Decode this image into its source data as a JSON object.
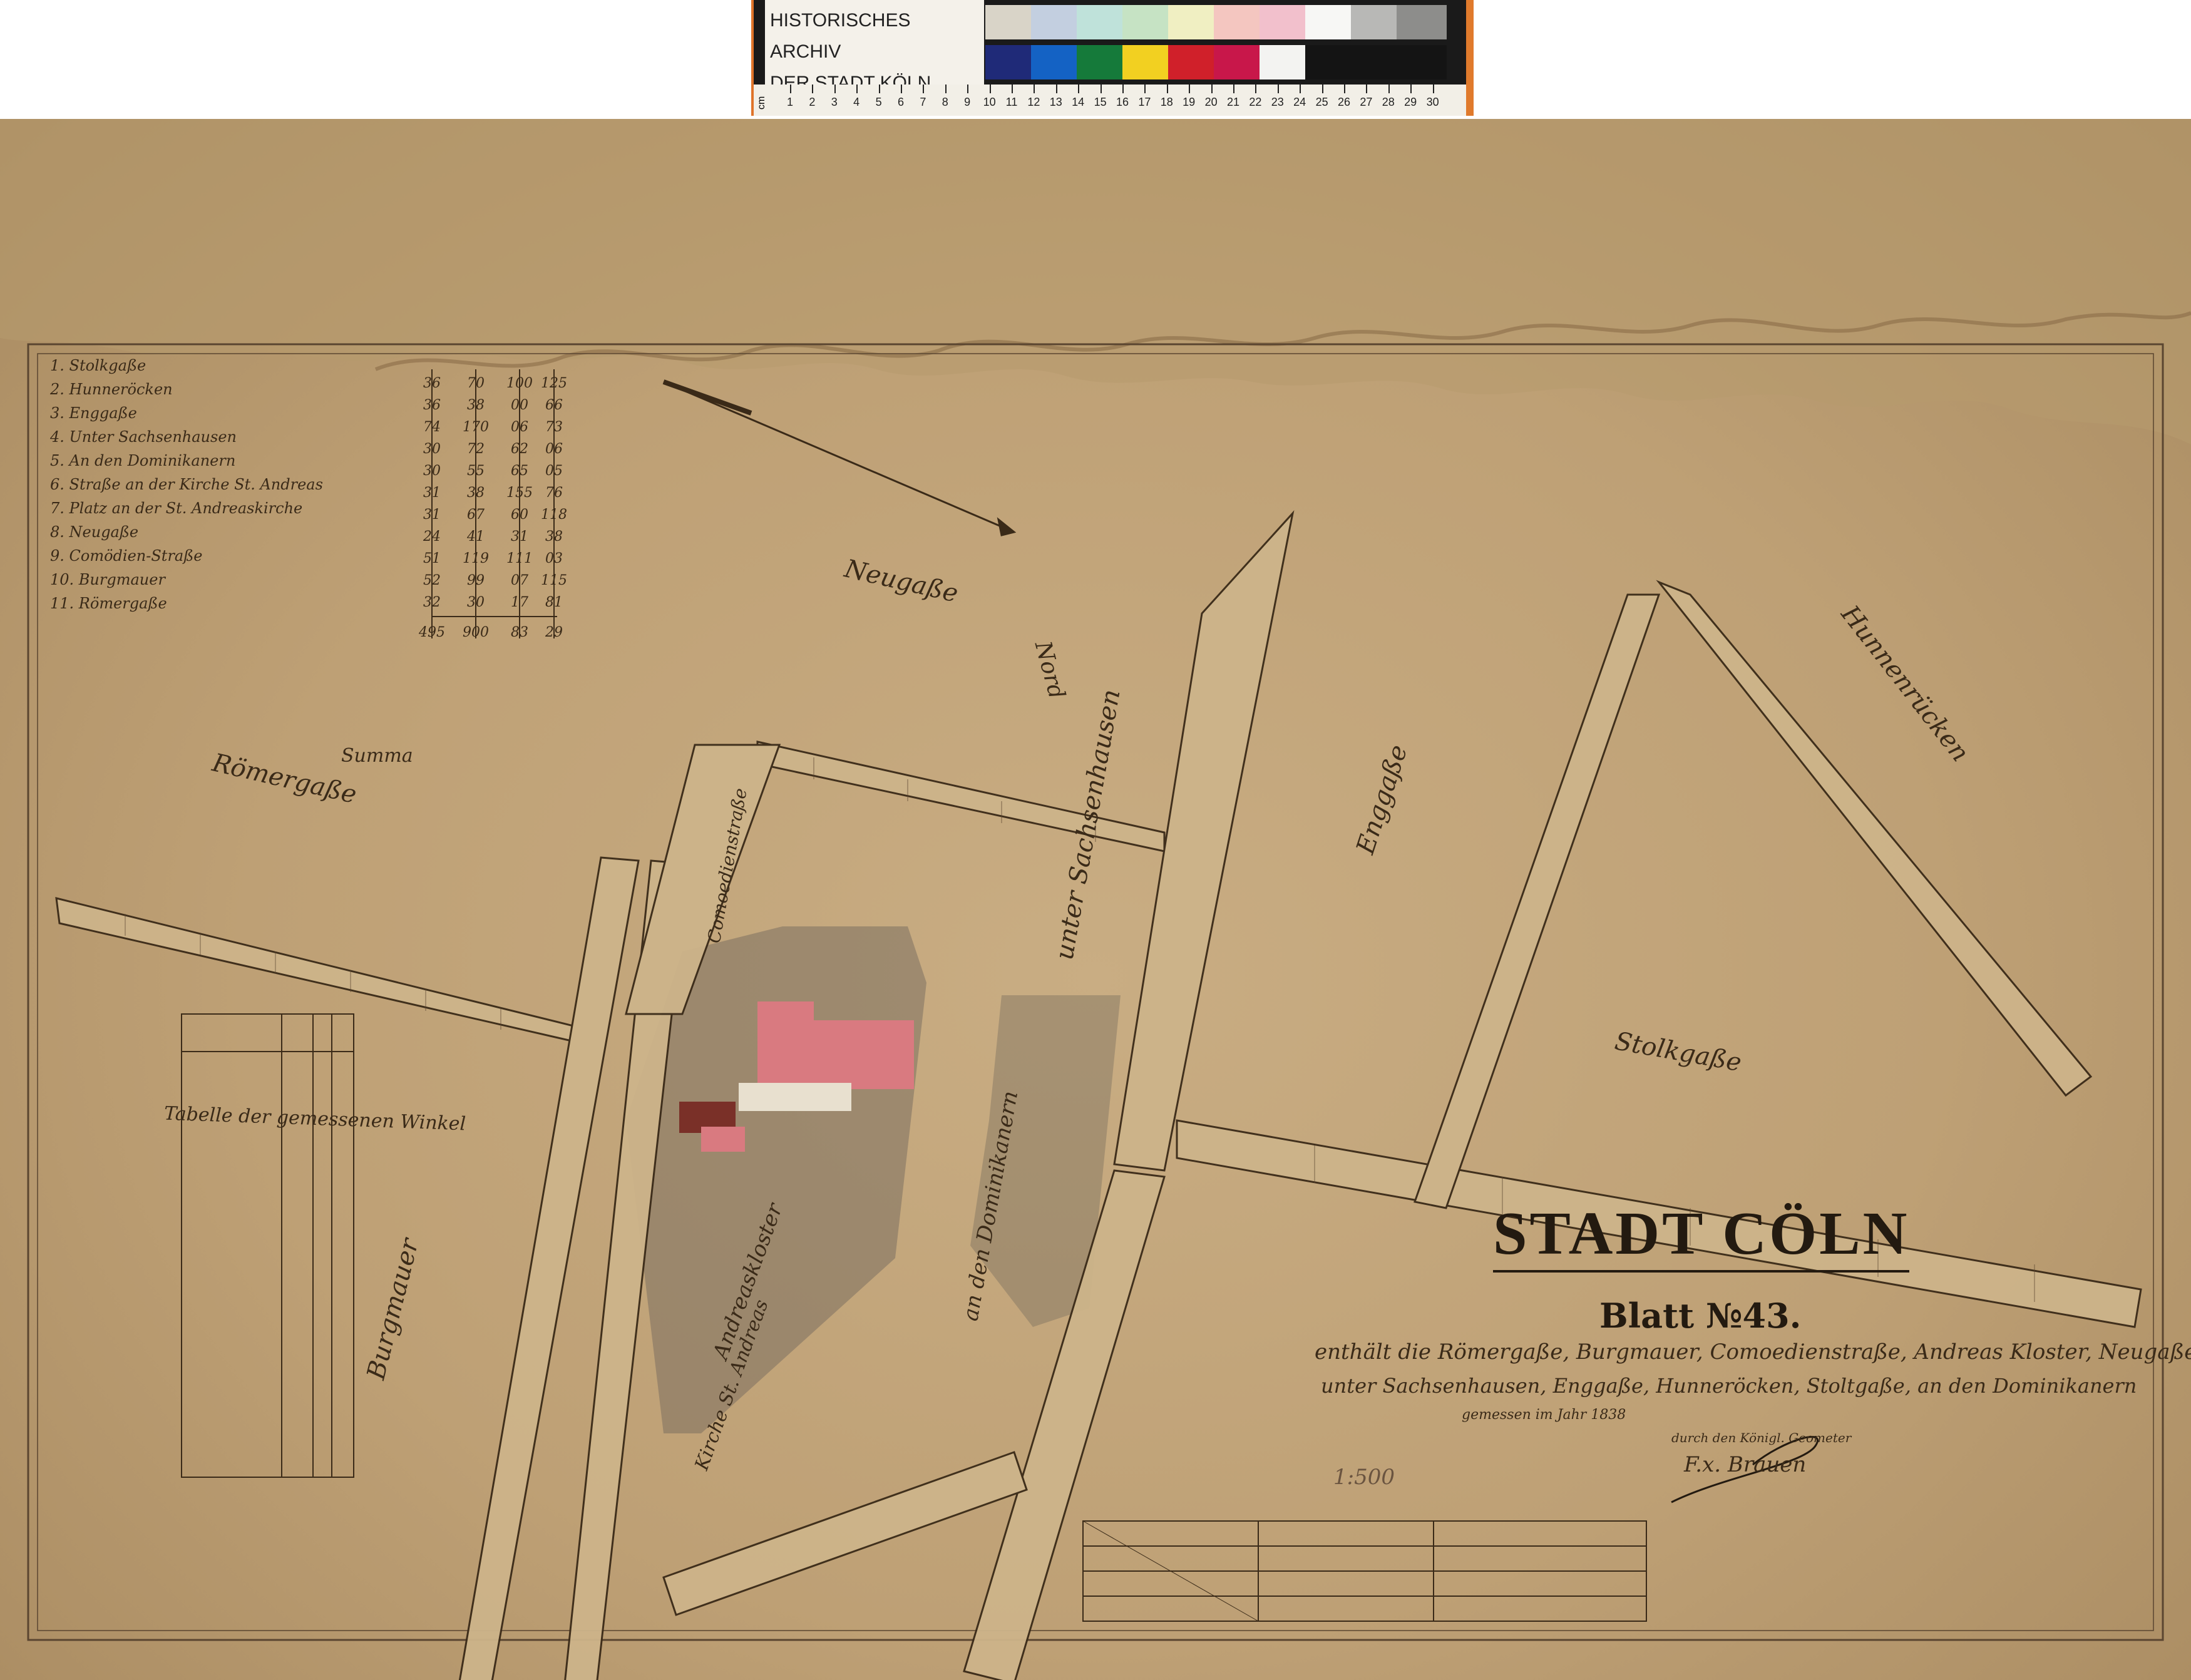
{
  "archive": {
    "line1": "HISTORISCHES ARCHIV",
    "line2": "DER STADT KÖLN"
  },
  "ruler": {
    "unit": "cm",
    "numbers": [
      "1",
      "2",
      "3",
      "4",
      "5",
      "6",
      "7",
      "8",
      "9",
      "10",
      "11",
      "12",
      "13",
      "14",
      "15",
      "16",
      "17",
      "18",
      "19",
      "20",
      "21",
      "22",
      "23",
      "24",
      "25",
      "26",
      "27",
      "28",
      "29",
      "30"
    ]
  },
  "calibration_colors": {
    "top": [
      "#d9d4c8",
      "#c3cfe0",
      "#bfe2da",
      "#c6e3c4",
      "#f0efc2",
      "#f4c6c0",
      "#f2c0cc",
      "#f7f7f5",
      "#b8b8b6",
      "#8d8d8b"
    ],
    "bottom": [
      "#1f2a78",
      "#1462c4",
      "#157a3a",
      "#f2d021",
      "#d0202a",
      "#c8174a",
      "#f3f3f1",
      "#141414",
      "#141414",
      "#141414"
    ]
  },
  "colors": {
    "parchment": "#bea075",
    "ink": "#3a2a18",
    "building_pink": "#d97a80",
    "church_gray": "#7c7060"
  },
  "map": {
    "title": "STADT CÖLN",
    "sheet": "Blatt №43.",
    "contents_line1": "enthält die Römergaße, Burgmauer, Comoedienstraße, Andreas Kloster, Neugaße",
    "contents_line2": "unter Sachsenhausen, Enggaße, Hunneröcken, Stoltgaße, an den Dominikanern",
    "measured": "gemessen im Jahr 1838",
    "by": "durch den Königl. Geometer",
    "signature": "F.x. Brauen",
    "scale_note": "1:500",
    "north": "Nord",
    "summa": "Summa",
    "angle_table_title": "Tabelle der gemessenen Winkel"
  },
  "index_list": [
    "Stolkgaße",
    "Hunneröcken",
    "Enggaße",
    "Unter Sachsenhausen",
    "An den Dominikanern",
    "Straße an der Kirche St. Andreas",
    "Platz an der St. Andreaskirche",
    "Neugaße",
    "Comödien-Straße",
    "Burgmauer",
    "Römergaße"
  ],
  "index_numbers": [
    [
      "36",
      "70",
      "100",
      "125"
    ],
    [
      "36",
      "38",
      "00",
      "66"
    ],
    [
      "74",
      "170",
      "06",
      "73"
    ],
    [
      "30",
      "72",
      "62",
      "06"
    ],
    [
      "30",
      "55",
      "65",
      "05"
    ],
    [
      "31",
      "38",
      "155",
      "76"
    ],
    [
      "31",
      "67",
      "60",
      "118"
    ],
    [
      "24",
      "41",
      "31",
      "38"
    ],
    [
      "51",
      "119",
      "111",
      "03"
    ],
    [
      "52",
      "99",
      "07",
      "115"
    ],
    [
      "32",
      "30",
      "17",
      "81"
    ]
  ],
  "summa_numbers": [
    "495",
    "900",
    "83",
    "29"
  ],
  "streets": {
    "roemergasse": "Römergaße",
    "neugasse": "Neugaße",
    "unter_sachsenhausen": "unter Sachsenhausen",
    "enggasse": "Enggaße",
    "hunnenruecken": "Hunnenrücken",
    "stolkgasse": "Stolkgaße",
    "burgmauer": "Burgmauer",
    "an_den_dominikanern": "an den Dominikanern",
    "andreaskloster": "Andreaskloster",
    "kirche": "Kirche St. Andreas",
    "comoedien": "Comoedienstraße"
  }
}
